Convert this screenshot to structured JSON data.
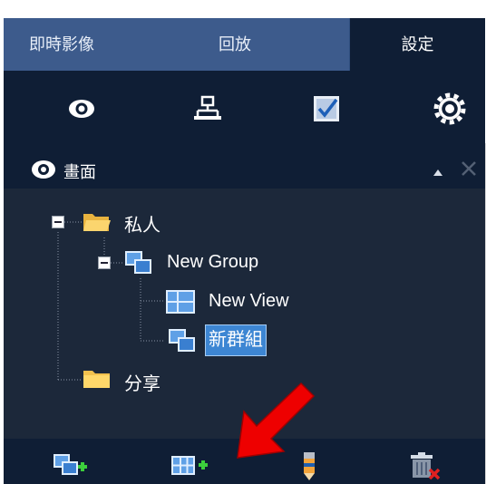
{
  "tabs": [
    {
      "label": "即時影像"
    },
    {
      "label": "回放"
    },
    {
      "label": "設定",
      "active": true
    }
  ],
  "icon_toolbar": [
    "eye-icon",
    "network-icon",
    "checklist-icon",
    "gear-icon"
  ],
  "section": {
    "title": "畫面",
    "icon": "eye-icon",
    "collapse_icon": "triangle-up-icon",
    "close_icon": "close-icon"
  },
  "tree": {
    "private": {
      "label": "私人",
      "expanded": true
    },
    "group": {
      "label": "New Group",
      "expanded": true
    },
    "view": {
      "label": "New View"
    },
    "new_group": {
      "label": "新群組",
      "selected": true
    },
    "shared": {
      "label": "分享"
    }
  },
  "bottom_toolbar": [
    "add-group-icon",
    "add-view-icon",
    "edit-icon",
    "delete-icon"
  ],
  "colors": {
    "panel_bg": "#0f1e35",
    "tab_bg": "#3d5b8c",
    "tree_bg": "#1c283a",
    "selection": "#3d86d3",
    "folder": "#e8b33f",
    "annotation_arrow": "#ee0000"
  }
}
